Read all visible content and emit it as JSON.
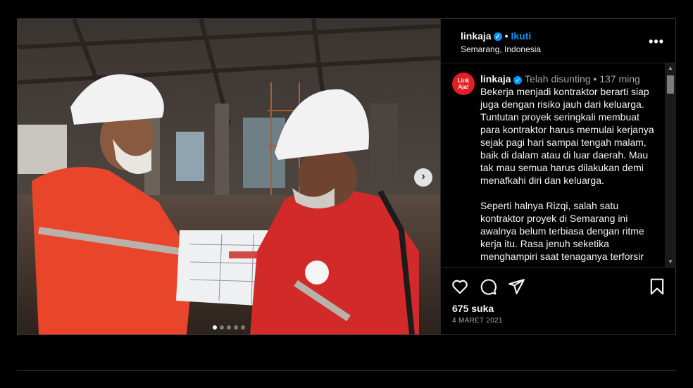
{
  "header": {
    "username": "linkaja",
    "verified": true,
    "follow_label": "Ikuti",
    "location": "Semarang, Indonesia",
    "more_label": "•••"
  },
  "caption": {
    "avatar_text": "Link Aja!",
    "username": "linkaja",
    "edited_label": "Telah disunting",
    "time_ago": "137 ming",
    "paragraph1": "Bekerja menjadi kontraktor berarti siap juga dengan risiko jauh dari keluarga. Tuntutan proyek seringkali membuat para kontraktor harus memulai kerjanya sejak pagi hari sampai tengah malam, baik di dalam atau di luar daerah. Mau tak mau semua harus dilakukan demi menafkahi diri dan keluarga.",
    "paragraph2": "Seperti halnya Rizqi, salah satu kontraktor proyek di Semarang ini awalnya belum terbiasa dengan ritme kerja itu. Rasa jenuh seketika menghampiri saat tenaganya terforsir"
  },
  "actions": {
    "likes": "675 suka",
    "date": "4 MARET 2021"
  },
  "carousel": {
    "total": 5,
    "current": 1
  },
  "colors": {
    "accent": "#0095f6",
    "brand_red": "#e31e24",
    "background": "#000000"
  },
  "icons": [
    "heart-icon",
    "comment-icon",
    "share-icon",
    "bookmark-icon",
    "chevron-right-icon",
    "more-icon",
    "verified-icon"
  ]
}
